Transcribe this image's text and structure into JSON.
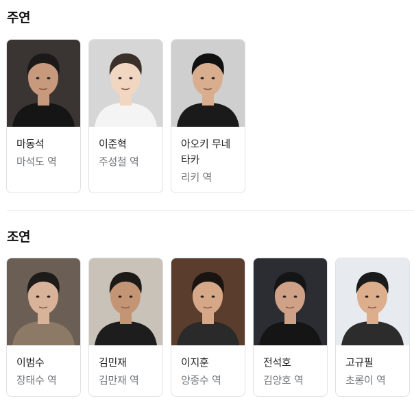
{
  "main_cast": {
    "title": "주연",
    "cards": [
      {
        "name": "마동석",
        "role": "마석도 역",
        "bg": "#3a3532",
        "skin": "#c79a7d",
        "hair": "#1c1a19",
        "shirt": "#151515"
      },
      {
        "name": "이준혁",
        "role": "주성철 역",
        "bg": "#d6d6d6",
        "skin": "#f1d6c2",
        "hair": "#3a2f29",
        "shirt": "#f4f4f4"
      },
      {
        "name": "아오키 무네타카",
        "role": "리키 역",
        "bg": "#cfcfcf",
        "skin": "#d9ae8f",
        "hair": "#111111",
        "shirt": "#1a1a1a"
      }
    ]
  },
  "supporting_cast": {
    "title": "조연",
    "cards": [
      {
        "name": "이범수",
        "role": "장태수 역",
        "bg": "#6b5e55",
        "skin": "#d8b399",
        "hair": "#1e1a17",
        "shirt": "#8c7a66"
      },
      {
        "name": "김민재",
        "role": "김만재 역",
        "bg": "#c9c2b8",
        "skin": "#c49575",
        "hair": "#1c1916",
        "shirt": "#1d1d1d"
      },
      {
        "name": "이지훈",
        "role": "양종수 역",
        "bg": "#5a3d2c",
        "skin": "#d6a888",
        "hair": "#1a1410",
        "shirt": "#2a2a2a"
      },
      {
        "name": "전석호",
        "role": "김양호 역",
        "bg": "#2b2d33",
        "skin": "#cfa287",
        "hair": "#151515",
        "shirt": "#151515"
      },
      {
        "name": "고규필",
        "role": "초롱이 역",
        "bg": "#e7eaee",
        "skin": "#dcae8c",
        "hair": "#1b1b1b",
        "shirt": "#2c2c2c"
      }
    ]
  }
}
